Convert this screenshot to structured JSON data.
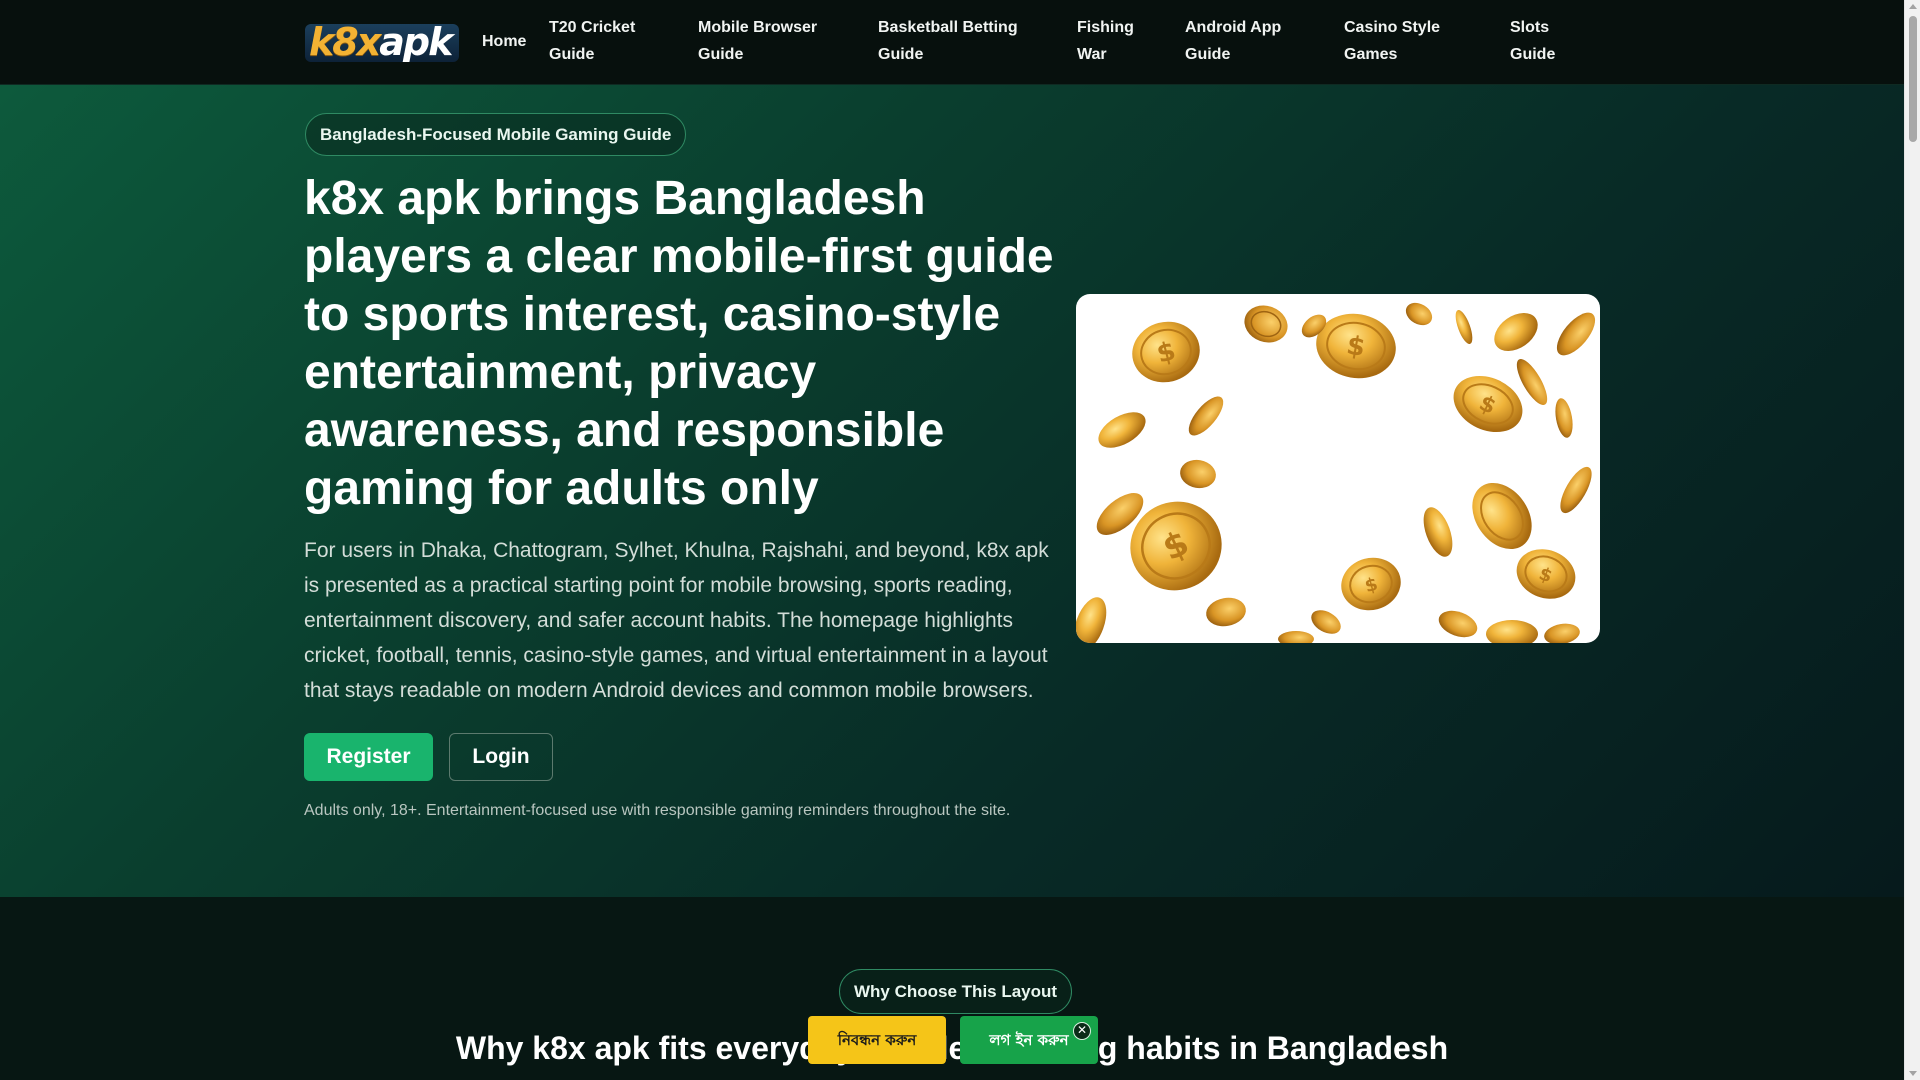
{
  "header": {
    "logo": {
      "part1": "k8x",
      "part2": "apk"
    },
    "nav": [
      "Home",
      "T20 Cricket Guide",
      "Mobile Browser Guide",
      "Basketball Betting Guide",
      "Fishing War",
      "Android App Guide",
      "Casino Style Games",
      "Slots Guide"
    ]
  },
  "hero": {
    "badge": "Bangladesh-Focused Mobile Gaming Guide",
    "title": "k8x apk brings Bangladesh players a clear mobile-first guide to sports interest, casino-style entertainment, privacy awareness, and responsible gaming for adults only",
    "description": "For users in Dhaka, Chattogram, Sylhet, Khulna, Rajshahi, and beyond, k8x apk is presented as a practical starting point for mobile browsing, sports reading, entertainment discovery, and safer account habits. The homepage highlights cricket, football, tennis, casino-style games, and virtual entertainment in a layout that stays readable on modern Android devices and common mobile browsers.",
    "register_label": "Register",
    "login_label": "Login",
    "note": "Adults only, 18+. Entertainment-focused use with responsible gaming reminders throughout the site.",
    "image_icon": "gold-coins-illustration"
  },
  "section2": {
    "badge": "Why Choose This Layout",
    "title": "Why k8x apk fits everyday mobile browsing habits in Bangladesh"
  },
  "floating": {
    "register_label": "নিবন্ধন করুন",
    "login_label": "লগ ইন করুন",
    "close_icon": "close-icon",
    "register_color": "#f5c518",
    "login_color": "#17a34a"
  },
  "colors": {
    "accent": "#19b46d",
    "coin_gold": "#e0a52a"
  }
}
